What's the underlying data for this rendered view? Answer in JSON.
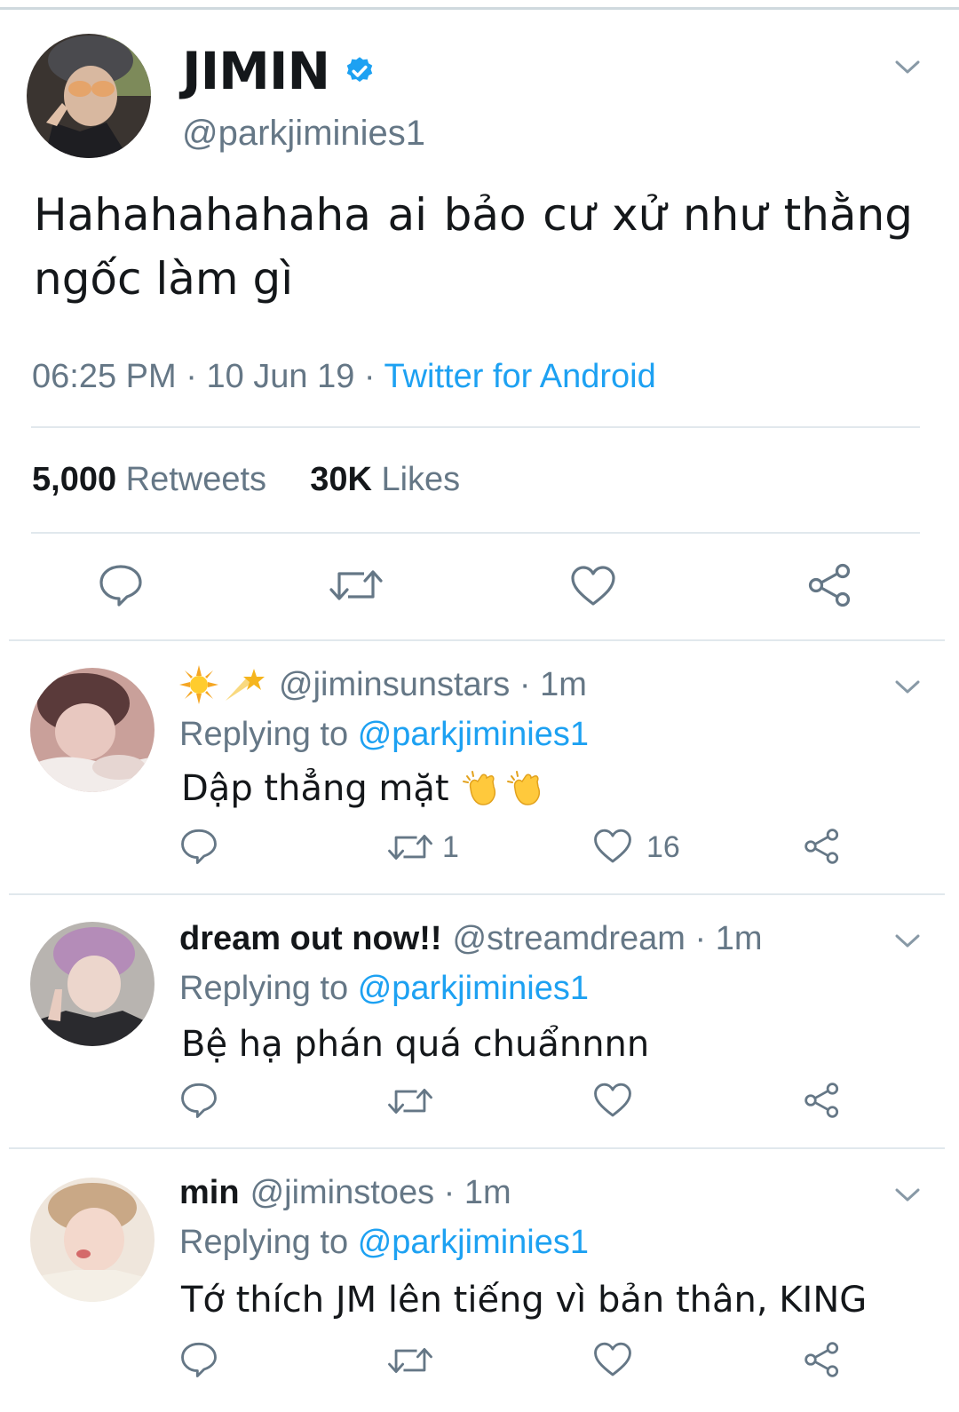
{
  "main_tweet": {
    "author_name": "JIMIN",
    "handle": "@parkjiminies1",
    "text": "Hahahahahaha ai bảo cư xử như thằng ngốc làm gì",
    "time": "06:25 PM",
    "date": "10 Jun 19",
    "separator": " · ",
    "source": "Twitter for Android",
    "retweet_count": "5,000",
    "retweet_label": "Retweets",
    "like_count": "30K",
    "like_label": "Likes"
  },
  "replies": [
    {
      "name_emoji": [
        "sun-emoji",
        "shooting-star-emoji"
      ],
      "handle": "@jiminsunstars",
      "age": "· 1m",
      "replying_prefix": "Replying to",
      "replying_to": "@parkjiminies1",
      "text": "Dập thẳng mặt",
      "text_emoji": [
        "clapping-hands-emoji",
        "clapping-hands-emoji"
      ],
      "retweets": "1",
      "likes": "16"
    },
    {
      "name": "dream out now!!",
      "handle": "@streamdream",
      "age": "· 1m",
      "replying_prefix": "Replying to",
      "replying_to": "@parkjiminies1",
      "text": "Bệ hạ phán quá chuẩnnnn"
    },
    {
      "name": "min",
      "handle": "@jiminstoes",
      "age": "· 1m",
      "replying_prefix": "Replying to",
      "replying_to": "@parkjiminies1",
      "text": "Tớ thích JM lên tiếng vì bản thân, KING"
    }
  ],
  "colors": {
    "twitter_blue": "#1da1f2",
    "secondary_text": "#657786",
    "primary_text": "#14171a",
    "divider": "#e1e8ed"
  }
}
